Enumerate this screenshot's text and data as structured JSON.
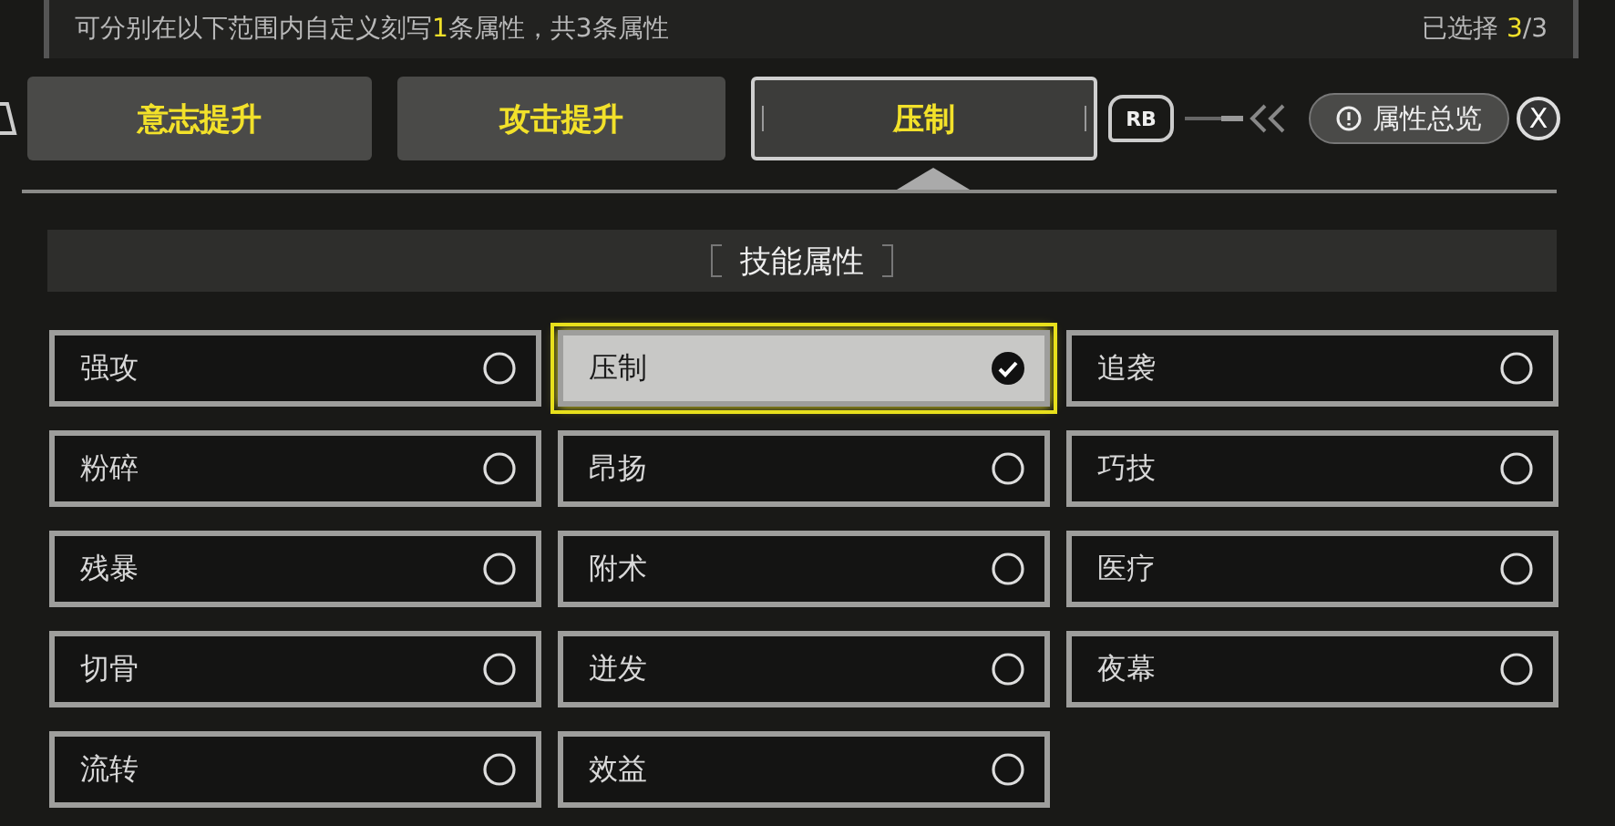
{
  "header": {
    "hint": [
      {
        "text": "可分别在以下范围内自定义刻写",
        "highlight": false
      },
      {
        "text": "1",
        "highlight": true
      },
      {
        "text": "条属性，共3条属性",
        "highlight": false
      }
    ],
    "selection": [
      {
        "text": "已选择 ",
        "highlight": false
      },
      {
        "text": "3",
        "highlight": true
      },
      {
        "text": "/3",
        "highlight": false
      }
    ]
  },
  "tabs": [
    {
      "label": "意志提升",
      "selected": false
    },
    {
      "label": "攻击提升",
      "selected": false
    },
    {
      "label": "压制",
      "selected": true
    }
  ],
  "next_tab_key": "RB",
  "overview_button": "属性总览",
  "close_key": "X",
  "section_title": "技能属性",
  "options": [
    {
      "label": "强攻",
      "selected": false
    },
    {
      "label": "压制",
      "selected": true
    },
    {
      "label": "追袭",
      "selected": false
    },
    {
      "label": "粉碎",
      "selected": false
    },
    {
      "label": "昂扬",
      "selected": false
    },
    {
      "label": "巧技",
      "selected": false
    },
    {
      "label": "残暴",
      "selected": false
    },
    {
      "label": "附术",
      "selected": false
    },
    {
      "label": "医疗",
      "selected": false
    },
    {
      "label": "切骨",
      "selected": false
    },
    {
      "label": "迸发",
      "selected": false
    },
    {
      "label": "夜幕",
      "selected": false
    },
    {
      "label": "流转",
      "selected": false
    },
    {
      "label": "效益",
      "selected": false
    }
  ]
}
